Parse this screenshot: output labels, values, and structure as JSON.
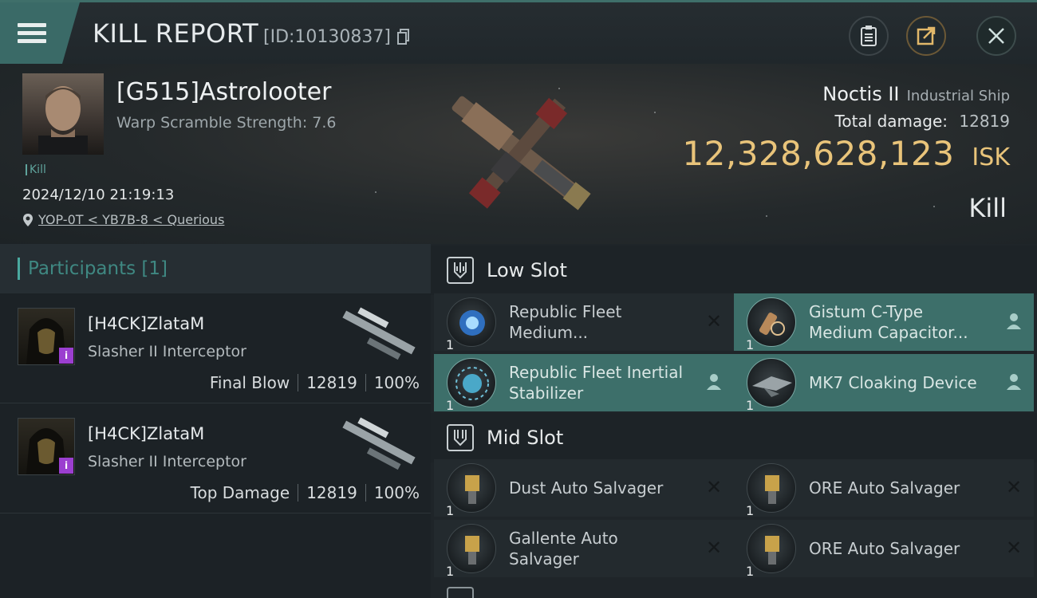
{
  "header": {
    "title": "KILL REPORT",
    "id_text": "[ID:10130837]"
  },
  "victim": {
    "name": "[G515]Astrolooter",
    "subtitle": "Warp Scramble Strength: 7.6",
    "tag": "Kill",
    "timestamp": "2024/12/10 21:19:13",
    "location": "YOP-0T < YB7B-8 < Querious"
  },
  "ship": {
    "name": "Noctis II",
    "class": "Industrial Ship",
    "total_damage_label": "Total damage:",
    "total_damage_value": "12819",
    "isk_value": "12,328,628,123",
    "isk_unit": "ISK",
    "kill_type": "Kill"
  },
  "participants": {
    "header": "Participants [1]",
    "rows": [
      {
        "name": "[H4CK]ZlataM",
        "ship": "Slasher II Interceptor",
        "role": "Final Blow",
        "damage": "12819",
        "percent": "100%"
      },
      {
        "name": "[H4CK]ZlataM",
        "ship": "Slasher II Interceptor",
        "role": "Top Damage",
        "damage": "12819",
        "percent": "100%"
      }
    ]
  },
  "low_slot": {
    "label": "Low Slot",
    "modules": [
      {
        "name_line1": "Republic Fleet",
        "name_line2": "Medium...",
        "qty": "1",
        "action": "close-icon",
        "highlight": false
      },
      {
        "name_line1": "Gistum C-Type",
        "name_line2": "Medium Capacitor...",
        "qty": "1",
        "action": "person-icon",
        "highlight": true
      },
      {
        "name_line1": "Republic Fleet Inertial",
        "name_line2": "Stabilizer",
        "qty": "1",
        "action": "person-icon",
        "highlight": true
      },
      {
        "name_line1": "MK7 Cloaking Device",
        "name_line2": "",
        "qty": "1",
        "action": "person-icon",
        "highlight": true
      }
    ]
  },
  "mid_slot": {
    "label": "Mid Slot",
    "modules": [
      {
        "name_line1": "Dust Auto Salvager",
        "name_line2": "",
        "qty": "1",
        "action": "close-icon",
        "highlight": false
      },
      {
        "name_line1": "ORE Auto Salvager",
        "name_line2": "",
        "qty": "1",
        "action": "close-icon",
        "highlight": false
      },
      {
        "name_line1": "Gallente Auto",
        "name_line2": "Salvager",
        "qty": "1",
        "action": "close-icon",
        "highlight": false
      },
      {
        "name_line1": "ORE Auto Salvager",
        "name_line2": "",
        "qty": "1",
        "action": "close-icon",
        "highlight": false
      }
    ]
  },
  "colors": {
    "accent": "#3d6f6a",
    "isk": "#e9c47a",
    "participant_badge": "#9b3fd0"
  }
}
